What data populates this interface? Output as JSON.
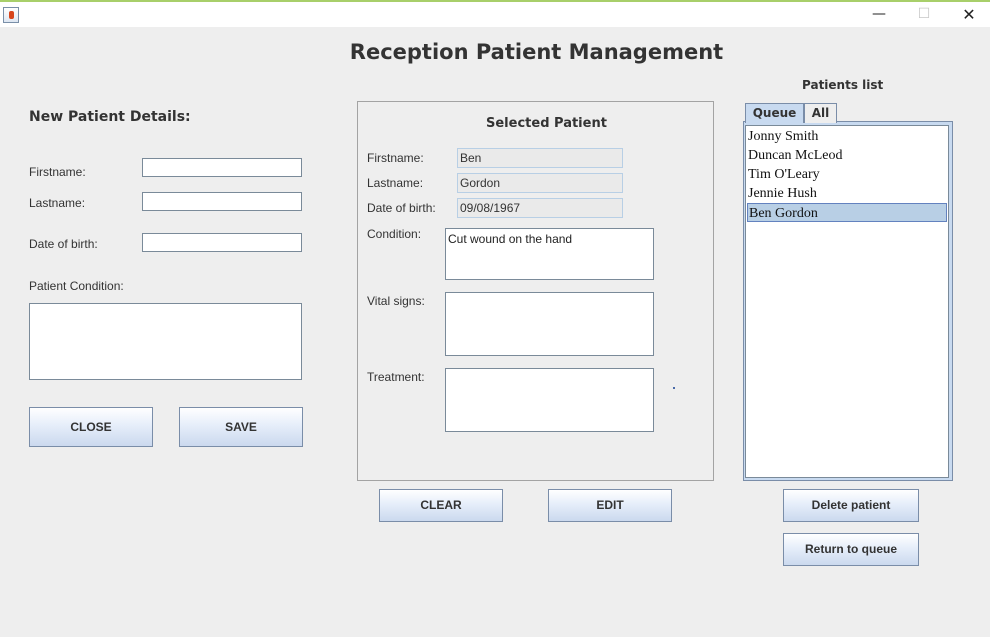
{
  "window": {
    "minimize": "—",
    "maximize": "☐",
    "close": "✕"
  },
  "title": "Reception Patient Management",
  "new_patient": {
    "heading": "New Patient Details:",
    "firstname_label": "Firstname:",
    "lastname_label": "Lastname:",
    "dob_label": "Date of birth:",
    "condition_label": "Patient Condition:",
    "firstname_value": "",
    "lastname_value": "",
    "dob_value": "",
    "condition_value": "",
    "close_btn": "CLOSE",
    "save_btn": "SAVE"
  },
  "selected": {
    "heading": "Selected Patient",
    "firstname_label": "Firstname:",
    "lastname_label": "Lastname:",
    "dob_label": "Date of birth:",
    "condition_label": "Condition:",
    "vital_label": "Vital signs:",
    "treatment_label": "Treatment:",
    "firstname": "Ben",
    "lastname": "Gordon",
    "dob": "09/08/1967",
    "condition": "Cut wound on the hand",
    "vital": "",
    "treatment": "",
    "clear_btn": "CLEAR",
    "edit_btn": "EDIT"
  },
  "patients": {
    "heading": "Patients list",
    "tabs": [
      "Queue",
      "All"
    ],
    "items": [
      "Jonny Smith",
      "Duncan McLeod",
      "Tim O'Leary",
      "Jennie Hush",
      "Ben Gordon"
    ],
    "selected_index": 4,
    "delete_btn": "Delete patient",
    "return_btn": "Return to queue"
  }
}
